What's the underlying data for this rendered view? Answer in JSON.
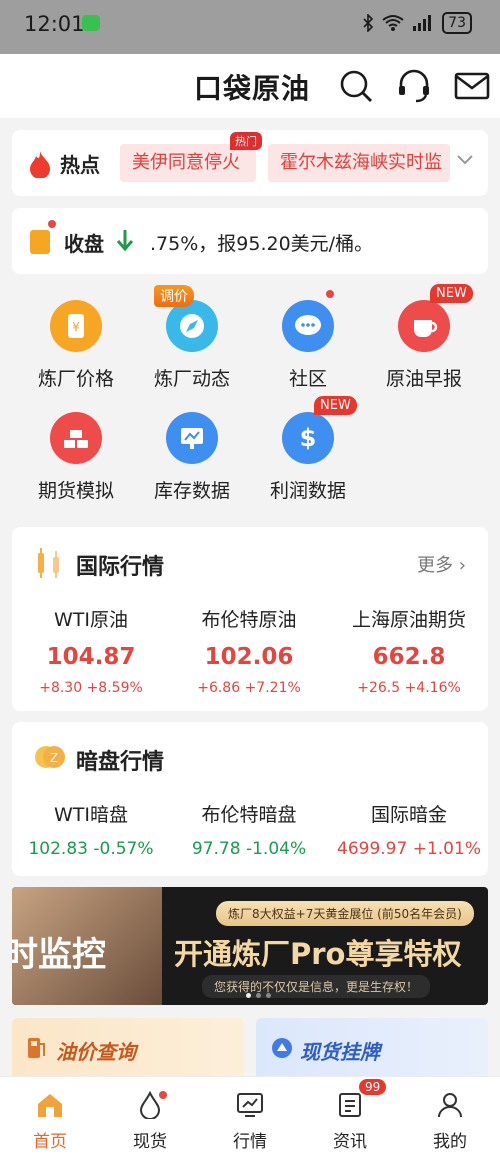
{
  "status_bar": {
    "time": "12:01",
    "battery": "73"
  },
  "header": {
    "logo": "口袋原油"
  },
  "hot": {
    "label": "热点",
    "items": [
      "美伊同意停火",
      "霍尔木兹海峡实时监"
    ],
    "badge": "热门"
  },
  "close_notice": {
    "label": "收盘",
    "text": ".75%，报95.20美元/桶。"
  },
  "grid": [
    {
      "label": "炼厂价格",
      "icon": "refinery-price-icon",
      "color": "#f6a623"
    },
    {
      "label": "炼厂动态",
      "icon": "refinery-news-icon",
      "color": "#39b8ea",
      "tag": "调价"
    },
    {
      "label": "社区",
      "icon": "community-icon",
      "color": "#3e8ff0"
    },
    {
      "label": "原油早报",
      "icon": "morning-report-icon",
      "color": "#ee4b4b",
      "badge": "NEW"
    },
    {
      "label": "期货模拟",
      "icon": "futures-sim-icon",
      "color": "#ee4b4b"
    },
    {
      "label": "库存数据",
      "icon": "inventory-icon",
      "color": "#3e8ff0"
    },
    {
      "label": "利润数据",
      "icon": "profit-icon",
      "color": "#3e8ff0",
      "badge": "NEW"
    }
  ],
  "intl_market": {
    "title": "国际行情",
    "more": "更多",
    "quotes": [
      {
        "name": "WTI原油",
        "price": "104.87",
        "change": "+8.30 +8.59%"
      },
      {
        "name": "布伦特原油",
        "price": "102.06",
        "change": "+6.86 +7.21%"
      },
      {
        "name": "上海原油期货",
        "price": "662.8",
        "change": "+26.5 +4.16%"
      }
    ]
  },
  "dark_market": {
    "title": "暗盘行情",
    "quotes": [
      {
        "name": "WTI暗盘",
        "value": "102.83 -0.57%",
        "color": "#1a9a52"
      },
      {
        "name": "布伦特暗盘",
        "value": "97.78 -1.04%",
        "color": "#1a9a52"
      },
      {
        "name": "国际暗金",
        "value": "4699.97 +1.01%",
        "color": "#e4463f"
      }
    ]
  },
  "banner": {
    "left_text": "时监控",
    "pill": "炼厂8大权益+7天黄金展位 (前50名年会员)",
    "main": "开通炼厂Pro尊享特权",
    "sub": "您获得的不仅仅是信息，更是生存权！"
  },
  "promos": {
    "oil_price": "油价查询",
    "spot": "现货挂牌"
  },
  "bottom_nav": [
    {
      "label": "首页",
      "icon": "home-icon",
      "active": true
    },
    {
      "label": "现货",
      "icon": "drop-icon"
    },
    {
      "label": "行情",
      "icon": "chart-icon"
    },
    {
      "label": "资讯",
      "icon": "news-icon",
      "badge": "99"
    },
    {
      "label": "我的",
      "icon": "profile-icon"
    }
  ]
}
